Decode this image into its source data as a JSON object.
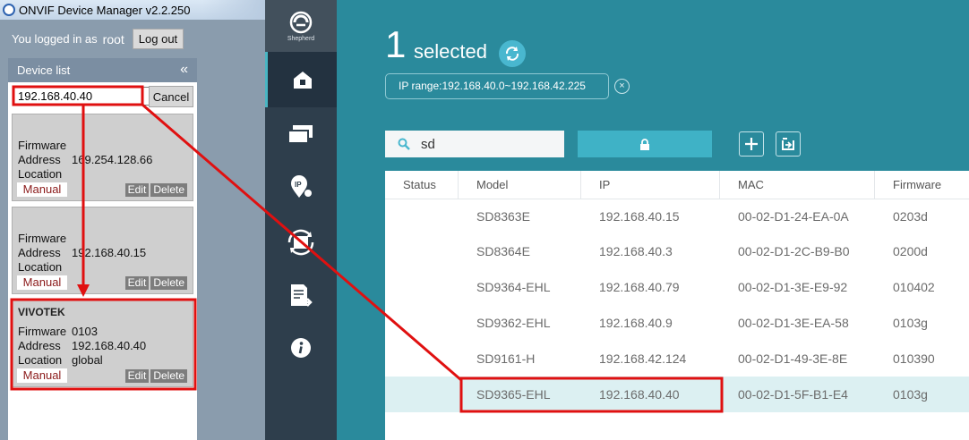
{
  "odm": {
    "window_title": "ONVIF Device Manager v2.2.250",
    "login_text": "You logged in as",
    "user": "root",
    "logout_label": "Log out",
    "device_list_title": "Device list",
    "collapse_glyph": "«",
    "search_value": "192.168.40.40",
    "cancel_label": "Cancel",
    "field_labels": {
      "firmware": "Firmware",
      "address": "Address",
      "location": "Location"
    },
    "manual_label": "Manual",
    "edit_label": "Edit",
    "delete_label": "Delete",
    "devices": [
      {
        "name": "",
        "firmware": "",
        "address": "169.254.128.66",
        "location": ""
      },
      {
        "name": "",
        "firmware": "",
        "address": "192.168.40.15",
        "location": ""
      },
      {
        "name": "VIVOTEK",
        "firmware": "0103",
        "address": "192.168.40.40",
        "location": "global"
      }
    ]
  },
  "nav": {
    "brand_label": "Shepherd",
    "items": [
      "home-icon",
      "devices-icon",
      "ip-location-icon",
      "refresh-cycle-icon",
      "export-document-icon",
      "info-icon"
    ]
  },
  "shepherd": {
    "selected_count": "1",
    "selected_label": "selected",
    "ip_range": "IP range:192.168.40.0~192.168.42.225",
    "ip_clear_glyph": "×",
    "search_value": "sd",
    "columns": [
      "Status",
      "Model",
      "IP",
      "MAC",
      "Firmware"
    ],
    "rows": [
      {
        "status": "",
        "model": "SD8363E",
        "ip": "192.168.40.15",
        "mac": "00-02-D1-24-EA-0A",
        "firmware": "0203d"
      },
      {
        "status": "",
        "model": "SD8364E",
        "ip": "192.168.40.3",
        "mac": "00-02-D1-2C-B9-B0",
        "firmware": "0200d"
      },
      {
        "status": "",
        "model": "SD9364-EHL",
        "ip": "192.168.40.79",
        "mac": "00-02-D1-3E-E9-92",
        "firmware": "010402"
      },
      {
        "status": "",
        "model": "SD9362-EHL",
        "ip": "192.168.40.9",
        "mac": "00-02-D1-3E-EA-58",
        "firmware": "0103g"
      },
      {
        "status": "",
        "model": "SD9161-H",
        "ip": "192.168.42.124",
        "mac": "00-02-D1-49-3E-8E",
        "firmware": "010390"
      },
      {
        "status": "",
        "model": "SD9365-EHL",
        "ip": "192.168.40.40",
        "mac": "00-02-D1-5F-B1-E4",
        "firmware": "0103g",
        "selected": true
      }
    ]
  },
  "colors": {
    "annotation_red": "#e01010",
    "shepherd_teal": "#2a8a9c",
    "nav_dark": "#2e3e4c",
    "accent_cyan": "#3fb2c6",
    "selected_row": "#dcf0f2"
  }
}
